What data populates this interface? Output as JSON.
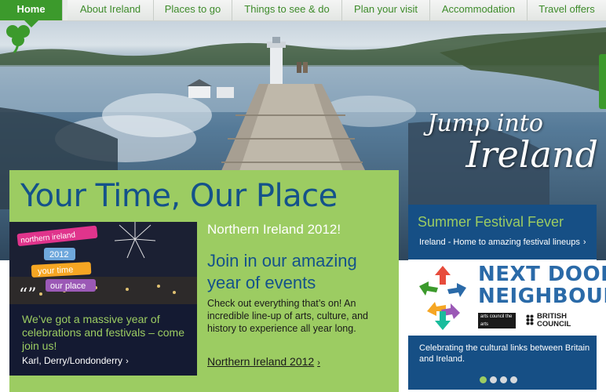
{
  "nav": {
    "items": [
      {
        "label": "Home",
        "active": true
      },
      {
        "label": "About Ireland",
        "active": false
      },
      {
        "label": "Places to go",
        "active": false
      },
      {
        "label": "Things to see & do",
        "active": false
      },
      {
        "label": "Plan your visit",
        "active": false
      },
      {
        "label": "Accommodation",
        "active": false
      },
      {
        "label": "Travel offers",
        "active": false
      }
    ]
  },
  "hero": {
    "line1": "Jump into",
    "line2": "Ireland",
    "icon": "shamrock-icon"
  },
  "feature": {
    "title": "Your Time, Our Place",
    "subtitle": "Northern Ireland 2012!",
    "heading": "Join in our amazing year of events",
    "body": "Check out everything that’s on! An incredible line-up of arts, culture, and history to experience all year long.",
    "link": "Northern Ireland 2012",
    "promo": {
      "badge_line1": "northern ireland",
      "badge_line2": "2012",
      "badge_line3": "your time",
      "badge_line4": "our place"
    },
    "quote": {
      "text": "We’ve got a massive year of celebrations and festivals – come join us!",
      "author": "Karl, Derry/Londonderry"
    }
  },
  "festival": {
    "title": "Summer Festival Fever",
    "sub": "Ireland - Home to amazing festival lineups"
  },
  "ndn": {
    "line1": "NEXT DOOR",
    "line2": "NEIGHBOURS",
    "arts_line1": "arts",
    "arts_line2": "council",
    "arts_line3": "the arts",
    "bc_line1": "BRITISH",
    "bc_line2": "COUNCIL"
  },
  "culture": {
    "text": "Celebrating the cultural links between Britain and Ireland.",
    "dots": [
      true,
      false,
      false,
      false
    ]
  },
  "colors": {
    "brand_green": "#3c9a2c",
    "panel_green": "#9ccc62",
    "navy": "#164f85",
    "title_blue": "#14528a"
  }
}
